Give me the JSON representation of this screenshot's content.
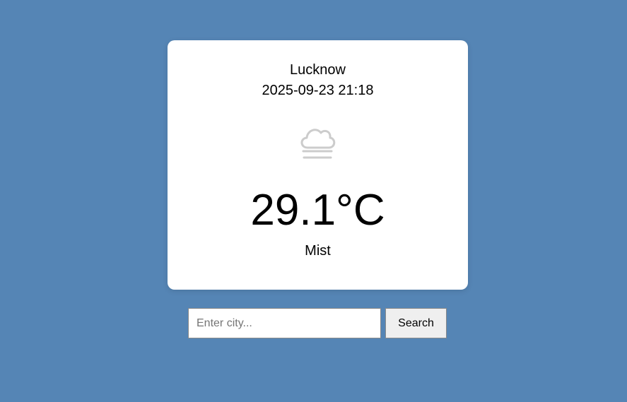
{
  "weather": {
    "city": "Lucknow",
    "datetime": "2025-09-23 21:18",
    "icon": "mist-icon",
    "temperature": "29.1°C",
    "description": "Mist"
  },
  "search": {
    "placeholder": "Enter city...",
    "value": "",
    "button_label": "Search"
  },
  "colors": {
    "background": "#5585b5",
    "card": "#ffffff",
    "icon": "#cccccc"
  }
}
